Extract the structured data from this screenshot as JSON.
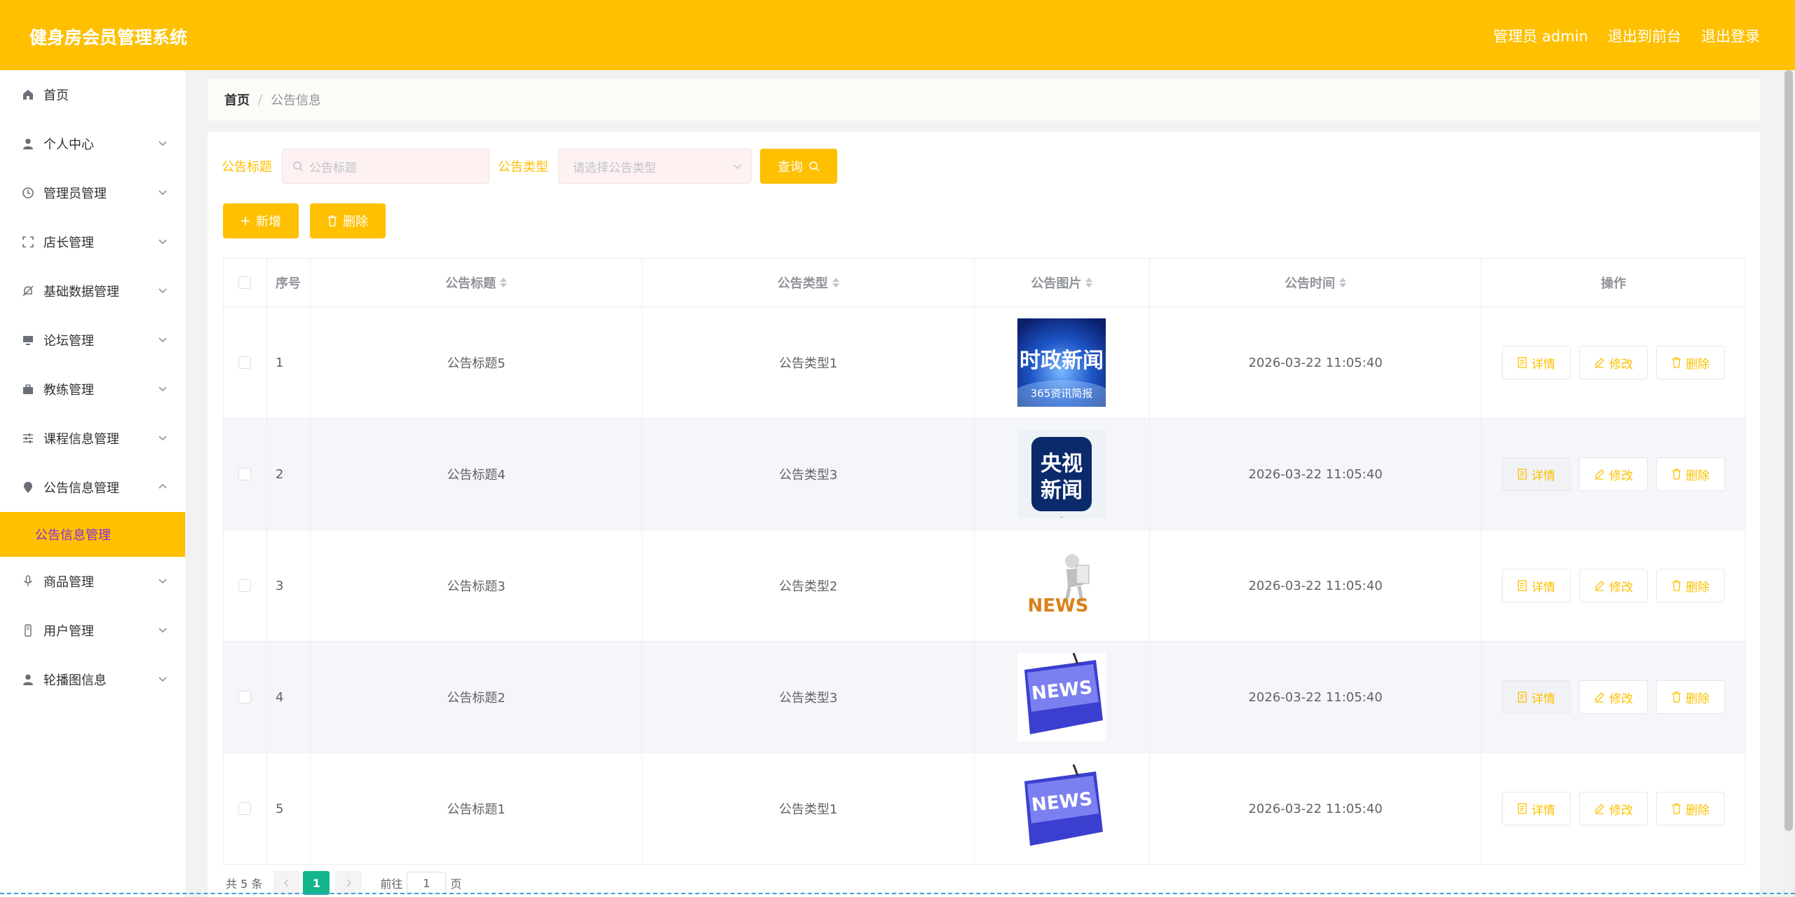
{
  "header": {
    "title": "健身房会员管理系统",
    "admin": "管理员 admin",
    "to_front": "退出到前台",
    "logout": "退出登录"
  },
  "sidebar": {
    "items": [
      {
        "label": "首页",
        "icon": "home-icon"
      },
      {
        "label": "个人中心",
        "icon": "user-icon"
      },
      {
        "label": "管理员管理",
        "icon": "clock-icon"
      },
      {
        "label": "店长管理",
        "icon": "fullscreen-icon"
      },
      {
        "label": "基础数据管理",
        "icon": "bell-off-icon"
      },
      {
        "label": "论坛管理",
        "icon": "monitor-icon"
      },
      {
        "label": "教练管理",
        "icon": "suitcase-icon"
      },
      {
        "label": "课程信息管理",
        "icon": "sliders-icon"
      },
      {
        "label": "公告信息管理",
        "icon": "location-icon"
      },
      {
        "label": "商品管理",
        "icon": "microphone-icon"
      },
      {
        "label": "用户管理",
        "icon": "phone-icon"
      },
      {
        "label": "轮播图信息",
        "icon": "user-icon"
      }
    ],
    "active_sub": "公告信息管理"
  },
  "breadcrumb": {
    "home": "首页",
    "sep": "/",
    "current": "公告信息"
  },
  "search": {
    "title_label": "公告标题",
    "title_placeholder": "公告标题",
    "type_label": "公告类型",
    "type_placeholder": "请选择公告类型",
    "query_button": "查询"
  },
  "actions": {
    "add": "新增",
    "delete": "删除"
  },
  "table": {
    "headers": [
      "序号",
      "公告标题",
      "公告类型",
      "公告图片",
      "公告时间",
      "操作"
    ],
    "rows": [
      {
        "index": "1",
        "title": "公告标题5",
        "type": "公告类型1",
        "image": "时政新闻",
        "time": "2026-03-22 11:05:40"
      },
      {
        "index": "2",
        "title": "公告标题4",
        "type": "公告类型3",
        "image": "央视新闻",
        "time": "2026-03-22 11:05:40"
      },
      {
        "index": "3",
        "title": "公告标题3",
        "type": "公告类型2",
        "image": "NEWS",
        "time": "2026-03-22 11:05:40"
      },
      {
        "index": "4",
        "title": "公告标题2",
        "type": "公告类型3",
        "image": "NEWS",
        "time": "2026-03-22 11:05:40"
      },
      {
        "index": "5",
        "title": "公告标题1",
        "type": "公告类型1",
        "image": "NEWS",
        "time": "2026-03-22 11:05:40"
      }
    ],
    "op_labels": {
      "detail": "详情",
      "edit": "修改",
      "delete": "删除"
    }
  },
  "pagination": {
    "total": "共 5 条",
    "current_page": "1",
    "goto_label": "前往",
    "goto_value": "1",
    "page_suffix": "页"
  },
  "colors": {
    "accent": "#fec000",
    "active_text": "#8a2be2",
    "pager_active": "#13b58b"
  }
}
